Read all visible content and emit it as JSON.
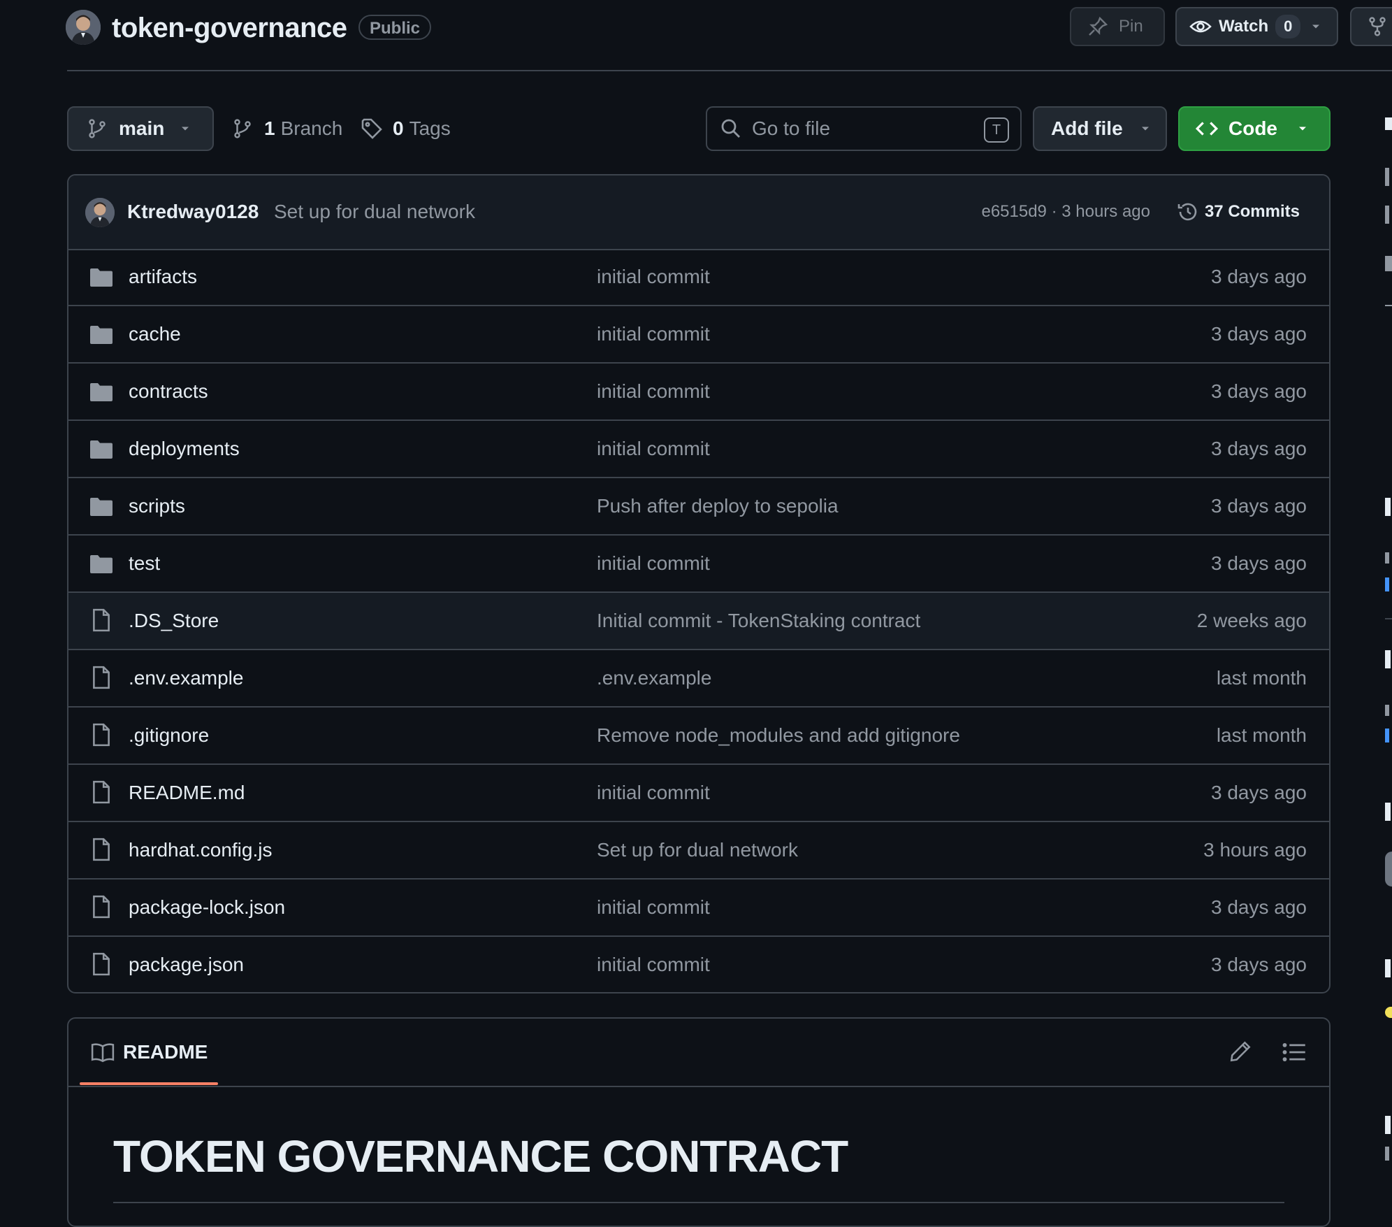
{
  "header": {
    "repo_name": "token-governance",
    "visibility": "Public",
    "pin_label": "Pin",
    "watch_label": "Watch",
    "watch_count": "0"
  },
  "toolbar": {
    "branch": "main",
    "branch_count": "1",
    "branch_label": "Branch",
    "tag_count": "0",
    "tag_label": "Tags",
    "search_placeholder": "Go to file",
    "search_shortcut": "T",
    "add_file_label": "Add file",
    "code_label": "Code"
  },
  "latest_commit": {
    "author": "Ktredway0128",
    "message": "Set up for dual network",
    "hash_time": "e6515d9 · 3 hours ago",
    "commits_label": "37 Commits"
  },
  "files": [
    {
      "name": "artifacts",
      "type": "folder",
      "message": "initial commit",
      "date": "3 days ago"
    },
    {
      "name": "cache",
      "type": "folder",
      "message": "initial commit",
      "date": "3 days ago"
    },
    {
      "name": "contracts",
      "type": "folder",
      "message": "initial commit",
      "date": "3 days ago"
    },
    {
      "name": "deployments",
      "type": "folder",
      "message": "initial commit",
      "date": "3 days ago"
    },
    {
      "name": "scripts",
      "type": "folder",
      "message": "Push after deploy to sepolia",
      "date": "3 days ago"
    },
    {
      "name": "test",
      "type": "folder",
      "message": "initial commit",
      "date": "3 days ago"
    },
    {
      "name": ".DS_Store",
      "type": "file",
      "message": "Initial commit - TokenStaking contract",
      "date": "2 weeks ago"
    },
    {
      "name": ".env.example",
      "type": "file",
      "message": ".env.example",
      "date": "last month"
    },
    {
      "name": ".gitignore",
      "type": "file",
      "message": "Remove node_modules and add gitignore",
      "date": "last month"
    },
    {
      "name": "README.md",
      "type": "file",
      "message": "initial commit",
      "date": "3 days ago"
    },
    {
      "name": "hardhat.config.js",
      "type": "file",
      "message": "Set up for dual network",
      "date": "3 hours ago"
    },
    {
      "name": "package-lock.json",
      "type": "file",
      "message": "initial commit",
      "date": "3 days ago"
    },
    {
      "name": "package.json",
      "type": "file",
      "message": "initial commit",
      "date": "3 days ago"
    }
  ],
  "readme": {
    "tab_label": "README",
    "heading": "TOKEN GOVERNANCE CONTRACT"
  },
  "colors": {
    "background": "#0d1117",
    "border": "#3d444d",
    "code_button": "#238636",
    "readme_tab_underline": "#f78166",
    "muted_text": "#9198a1"
  }
}
